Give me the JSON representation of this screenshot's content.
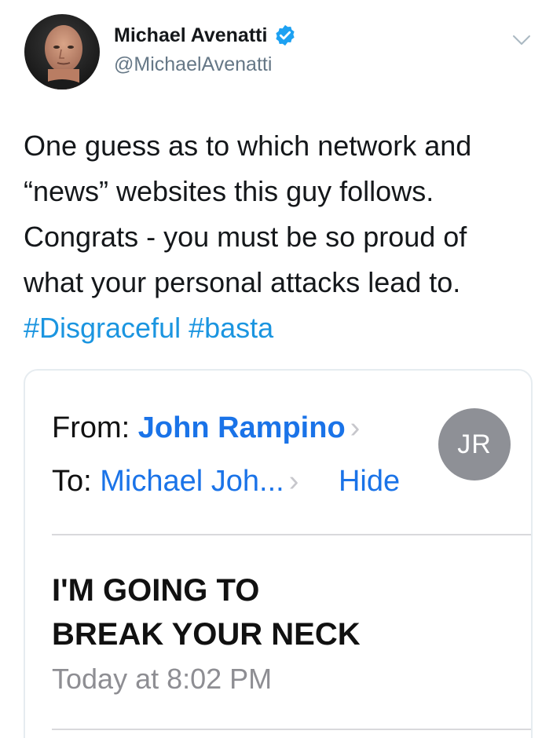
{
  "tweet": {
    "author": {
      "name": "Michael Avenatti",
      "handle": "@MichaelAvenatti",
      "verified": true,
      "avatar_icon": "profile-photo"
    },
    "menu_icon": "chevron-down-icon",
    "text_lines": [
      "One guess as to which network and",
      "“news” websites this guy follows.",
      "Congrats - you must be so proud of",
      "what your personal attacks lead to."
    ],
    "hashtags": [
      "#Disgraceful",
      "#basta"
    ]
  },
  "email_card": {
    "from_label": "From:",
    "sender_name": "John Rampino",
    "to_label": "To:",
    "recipient": "Michael Joh...",
    "hide_label": "Hide",
    "sender_initials": "JR",
    "subject_lines": [
      "I'M GOING TO",
      "BREAK YOUR NECK"
    ],
    "date": "Today at 8:02 PM"
  },
  "colors": {
    "hashtag": "#1b95e0",
    "verified_badge": "#1da1f2",
    "mail_link": "#1a73e8",
    "muted_text": "#657786",
    "initials_avatar_bg": "#8e9096"
  }
}
